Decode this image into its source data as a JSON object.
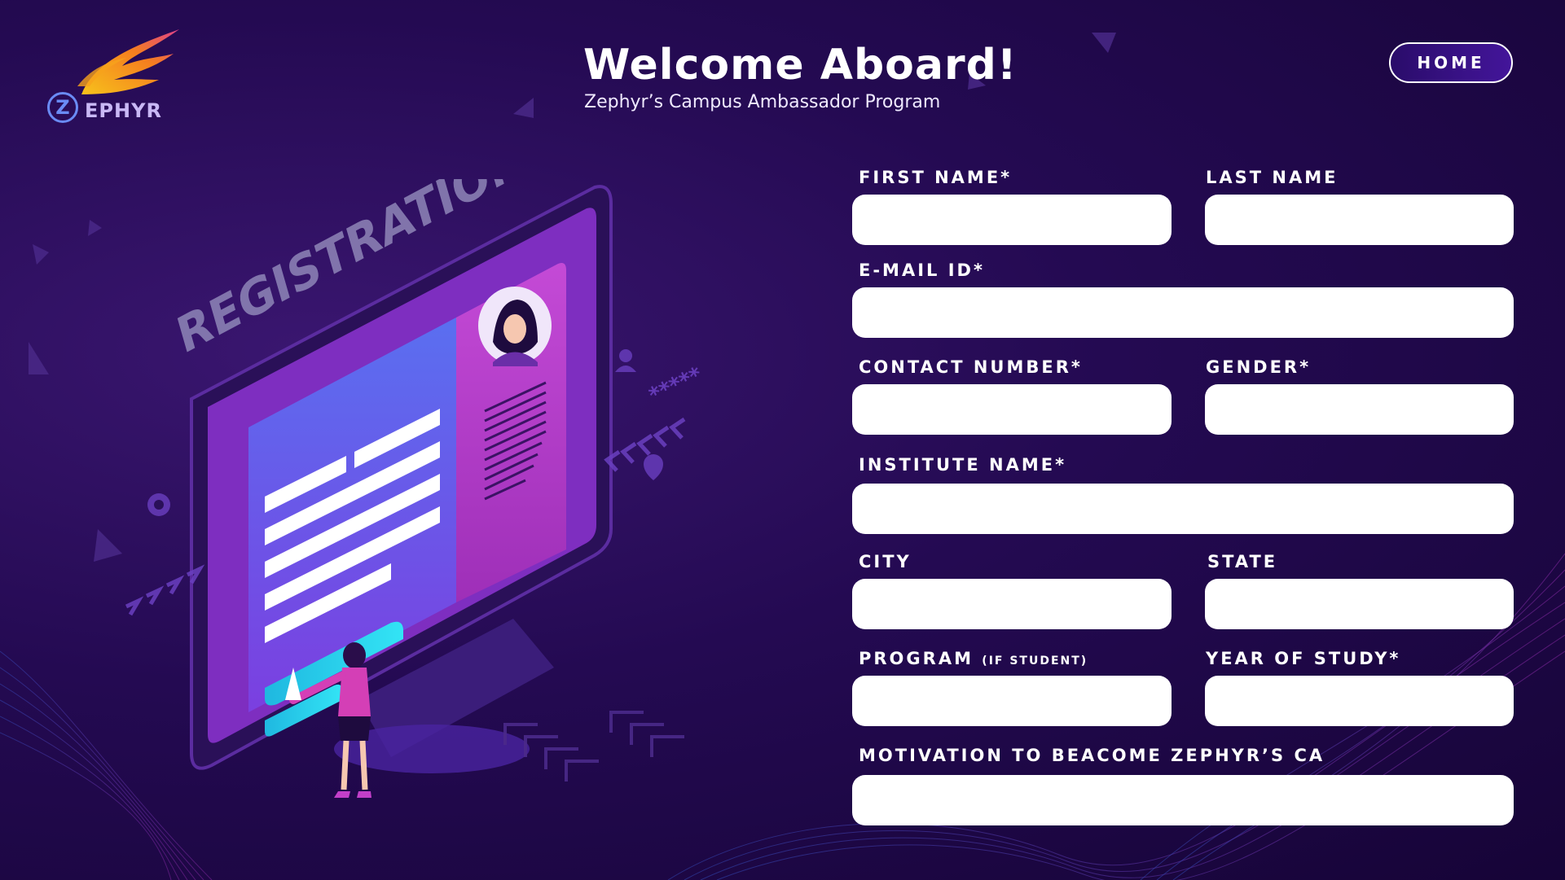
{
  "brand": {
    "logo_letter": "Z",
    "logo_text": "EPHYR"
  },
  "header": {
    "title": "Welcome Aboard!",
    "subtitle": "Zephyr’s Campus Ambassador Program",
    "home_label": "HOME"
  },
  "illustration": {
    "banner_text": "REGISTRATION",
    "password_mask": "*****"
  },
  "form": {
    "first_name": {
      "label": "FIRST NAME*",
      "value": "",
      "placeholder": ""
    },
    "last_name": {
      "label": "LAST NAME",
      "value": "",
      "placeholder": ""
    },
    "email": {
      "label": "E-MAIL ID*",
      "value": "",
      "placeholder": ""
    },
    "contact": {
      "label": "CONTACT NUMBER*",
      "value": "",
      "placeholder": ""
    },
    "gender": {
      "label": "GENDER*",
      "value": "",
      "placeholder": ""
    },
    "institute": {
      "label": "INSTITUTE NAME*",
      "value": "",
      "placeholder": ""
    },
    "city": {
      "label": "CITY",
      "value": "",
      "placeholder": ""
    },
    "state": {
      "label": "STATE",
      "value": "",
      "placeholder": ""
    },
    "program": {
      "label": "PROGRAM",
      "label_note": "(IF STUDENT)",
      "value": "",
      "placeholder": ""
    },
    "year": {
      "label": "YEAR OF STUDY*",
      "value": "",
      "placeholder": ""
    },
    "motivation": {
      "label": "MOTIVATION TO BEACOME ZEPHYR’S CA",
      "value": "",
      "placeholder": ""
    }
  },
  "colors": {
    "background": "#240a52",
    "accent_cyan": "#2fd7f0",
    "accent_magenta": "#c23fc9",
    "accent_violet": "#6a5fe0",
    "logo_flame": "#f7a21b"
  },
  "icons": [
    "flame-wings-icon",
    "gear-icon",
    "user-icon",
    "location-pin-icon",
    "chevron-arrows-icon",
    "paper-plane-icon"
  ]
}
